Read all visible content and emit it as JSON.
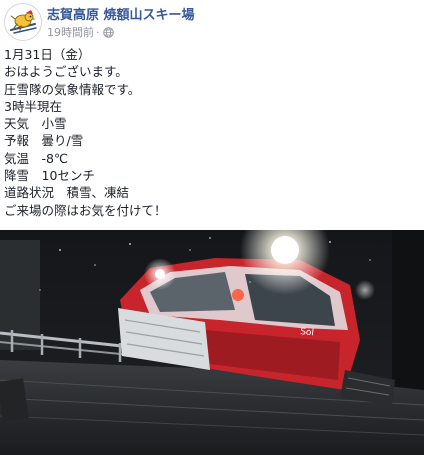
{
  "post": {
    "page_name": "志賀高原 焼額山スキー場",
    "timestamp": "19時間前",
    "separator": "·",
    "privacy_icon": "globe-icon",
    "avatar_icon": "ski-mascot-logo",
    "body_lines": [
      "1月31日（金）",
      "おはようございます。",
      "圧雪隊の気象情報です。",
      "3時半現在",
      "天気　小雪",
      "予報　曇り/雪",
      "気温　-8℃",
      "降雪　10センチ",
      "道路状況　積雪、凍結",
      "ご来場の際はお気を付けて！"
    ],
    "photo": {
      "subject": "snow-groomer-at-night"
    }
  },
  "colors": {
    "link": "#365899",
    "text": "#1d2129",
    "meta": "#90949c",
    "groomer_red": "#c8242b"
  }
}
